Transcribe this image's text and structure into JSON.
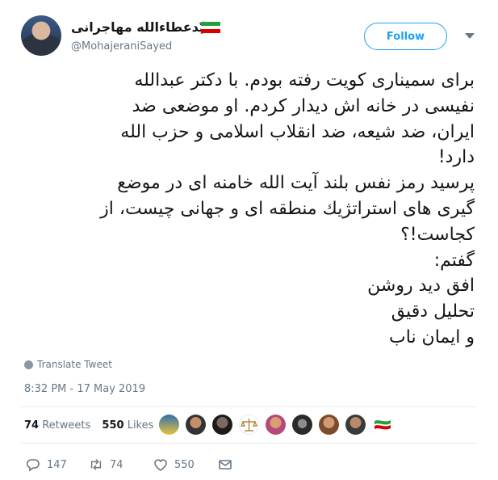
{
  "user": {
    "display_name": "سیّدعطاءالله مهاجرانی",
    "handle": "@MohajeraniSayed",
    "follow_label": "Follow"
  },
  "tweet": {
    "lines": [
      "برای سمیناری کویت رفته بودم. با دکتر عبدالله",
      "نفیسی در خانه اش دیدار کردم. او موضعی ضد",
      "ایران، ضد شیعه، ضد انقلاب اسلامی و حزب الله",
      "دارد!",
      "پرسید رمز  نفس بلند آیت الله خامنه ای در موضع",
      "گیری های استراتژیك منطقه ای و جهانی چیست، از",
      "کجاست!؟",
      "گفتم:",
      "افق دید روشن",
      "تحلیل دقیق",
      "و ایمان ناب"
    ],
    "translate_label": "Translate Tweet",
    "timestamp": "8:32 PM - 17 May 2019"
  },
  "stats": {
    "retweets_count": "74",
    "retweets_label": "Retweets",
    "likes_count": "550",
    "likes_label": "Likes"
  },
  "actions": {
    "reply_count": "147",
    "retweet_count": "74",
    "like_count": "550"
  },
  "colors": {
    "accent": "#1da1f2",
    "secondary_text": "#657786"
  }
}
